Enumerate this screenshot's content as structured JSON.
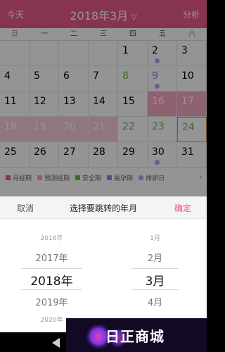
{
  "header": {
    "today": "今天",
    "month": "2018年3月",
    "analysis": "分析"
  },
  "weekdays": [
    "日",
    "一",
    "二",
    "三",
    "四",
    "五",
    "六"
  ],
  "calendar": {
    "rows": [
      [
        "",
        "",
        "",
        "",
        "1",
        "2",
        "3"
      ],
      [
        "4",
        "5",
        "6",
        "7",
        "8",
        "9",
        "10"
      ],
      [
        "11",
        "12",
        "13",
        "14",
        "15",
        "16",
        "17"
      ],
      [
        "18",
        "19",
        "20",
        "21",
        "22",
        "23",
        "24"
      ],
      [
        "25",
        "26",
        "27",
        "28",
        "29",
        "30",
        "31"
      ]
    ]
  },
  "legend": {
    "items": [
      {
        "label": "月经期",
        "color": "#e85a87"
      },
      {
        "label": "预测经期",
        "color": "#f8a0b8"
      },
      {
        "label": "安全期",
        "color": "#6cbb4d"
      },
      {
        "label": "易孕期",
        "color": "#b07be3"
      },
      {
        "label": "排卵日",
        "color": "#b8a3e8"
      }
    ],
    "more_icon": "chevron-right-icon"
  },
  "picker": {
    "cancel": "取消",
    "title": "选择要跳转的年月",
    "confirm": "确定",
    "years": [
      "2016年",
      "2017年",
      "2018年",
      "2019年",
      "2020年"
    ],
    "months": [
      "1月",
      "2月",
      "3月",
      "4月"
    ],
    "selected_year": "2018年",
    "selected_month": "3月"
  },
  "navbar": {
    "back_icon": "back-triangle-icon",
    "home_icon": "home-circle-icon"
  },
  "watermark": {
    "text": "日正商城"
  },
  "colors": {
    "accent": "#e85a87",
    "safe": "#6cbb4d",
    "fertile": "#b07be3",
    "ovulation": "#b8a3e8"
  }
}
